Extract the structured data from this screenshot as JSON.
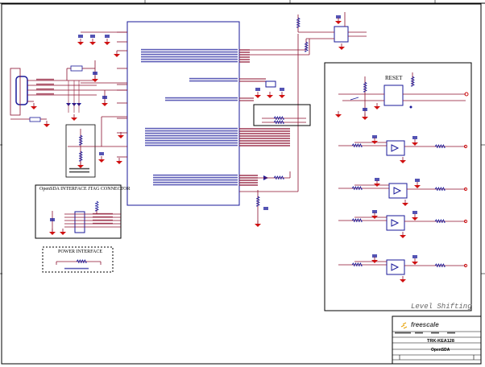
{
  "sections": {
    "jtag_title": "OpenSDA INTERFACE JTAG CONNECTOR",
    "power_title": "POWER INTERFACE",
    "reset_title": "RESET",
    "level_shifting": "Level Shifting"
  },
  "title_block": {
    "logo_text": "freescale",
    "board": "TRK-KEA128",
    "sheet_title": "OpenSDA"
  },
  "colors": {
    "wire": "#8b0f2e",
    "component": "#1a1a9a",
    "ground": "#d01010",
    "frame": "#000000"
  }
}
